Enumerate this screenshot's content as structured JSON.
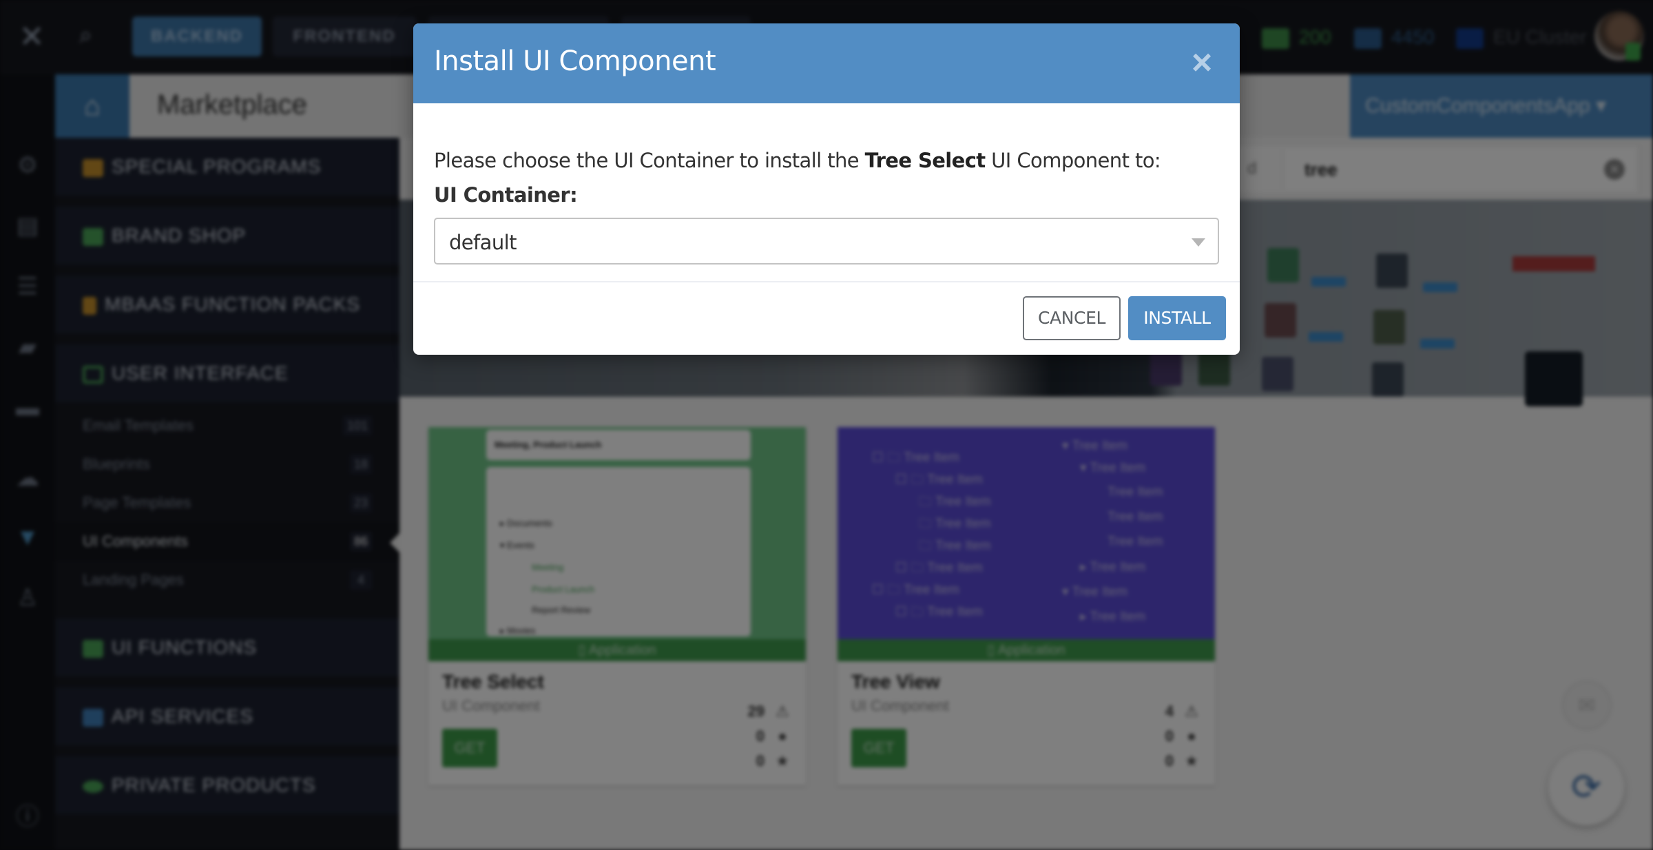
{
  "topbar": {
    "tabs": [
      {
        "label": "BACKEND",
        "active": true
      },
      {
        "label": "FRONTEND",
        "active": false
      },
      {
        "label": "",
        "active": false
      },
      {
        "label": "",
        "active": false
      }
    ],
    "stats": {
      "credits": "200",
      "learning": "4450",
      "cluster": "EU Cluster"
    }
  },
  "header": {
    "breadcrumb": "Marketplace",
    "app_selector": "CustomComponentsApp ▾"
  },
  "sidebar": {
    "categories": [
      {
        "label": "SPECIAL PROGRAMS",
        "icon": "sliders-icon",
        "color": "#c58f2a"
      },
      {
        "label": "BRAND SHOP",
        "icon": "store-icon",
        "color": "#4aa457"
      },
      {
        "label": "MBAAS FUNCTION PACKS",
        "icon": "box-icon",
        "color": "#c58f2a"
      },
      {
        "label": "USER INTERFACE",
        "icon": "monitor-icon",
        "color": "#4aa457"
      },
      {
        "label": "UI FUNCTIONS",
        "icon": "sliders-icon",
        "color": "#4aa457"
      },
      {
        "label": "API SERVICES",
        "icon": "sliders-icon",
        "color": "#3f7fb9"
      },
      {
        "label": "PRIVATE PRODUCTS",
        "icon": "eye-icon",
        "color": "#4aa457"
      }
    ],
    "user_interface_items": [
      {
        "label": "Email Templates",
        "count": "101",
        "active": false
      },
      {
        "label": "Blueprints",
        "count": "18",
        "active": false
      },
      {
        "label": "Page Templates",
        "count": "23",
        "active": false
      },
      {
        "label": "UI Components",
        "count": "86",
        "active": true
      },
      {
        "label": "Landing Pages",
        "count": "4",
        "active": false
      }
    ]
  },
  "filter": {
    "label": "d",
    "search_value": "tree"
  },
  "cards": [
    {
      "title": "Tree Select",
      "subtitle": "UI Component",
      "tag": "Application",
      "get_label": "GET",
      "downloads": "29",
      "comments": "0",
      "rating": "0",
      "preview": {
        "select_value": "Meeting, Product Launch",
        "rows": [
          "Documents",
          "Events",
          "Meeting",
          "Product Launch",
          "Report Review",
          "Movies"
        ]
      }
    },
    {
      "title": "Tree View",
      "subtitle": "UI Component",
      "tag": "Application",
      "get_label": "GET",
      "downloads": "4",
      "comments": "0",
      "rating": "0",
      "preview": {
        "item_label": "Tree Item"
      }
    }
  ],
  "modal": {
    "title": "Install UI Component",
    "message_prefix": "Please choose the UI Container to install the ",
    "message_component": "Tree Select",
    "message_suffix": " UI Component to:",
    "field_label": "UI Container:",
    "select_value": "default",
    "cancel_label": "CANCEL",
    "install_label": "INSTALL",
    "accent_color": "#528dc4"
  }
}
